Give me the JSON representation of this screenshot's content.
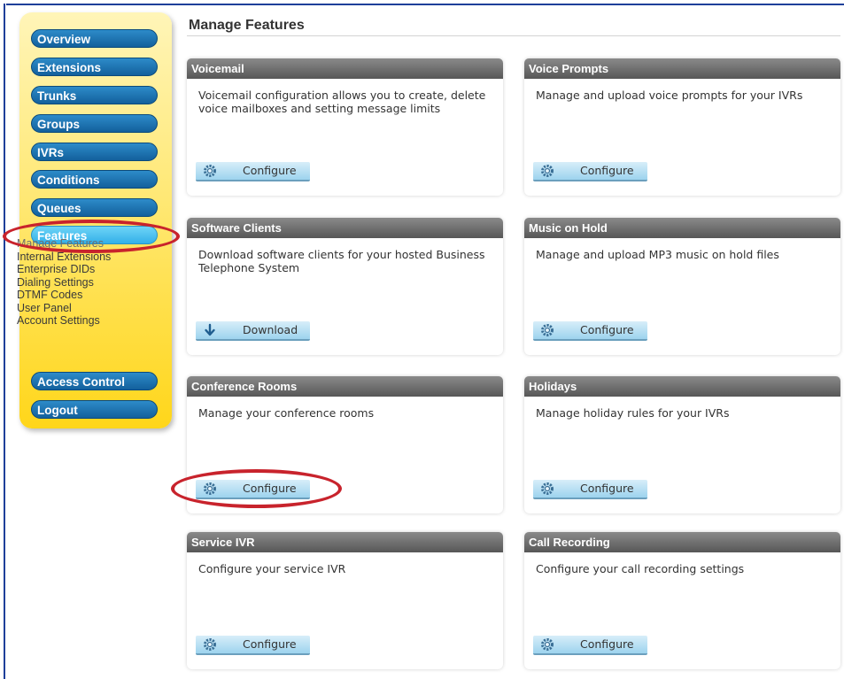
{
  "sidebar": {
    "items": [
      {
        "label": "Overview"
      },
      {
        "label": "Extensions"
      },
      {
        "label": "Trunks"
      },
      {
        "label": "Groups"
      },
      {
        "label": "IVRs"
      },
      {
        "label": "Conditions"
      },
      {
        "label": "Queues"
      },
      {
        "label": "Features",
        "active": true
      },
      {
        "label": "Access Control"
      },
      {
        "label": "Logout"
      }
    ],
    "submenu": [
      {
        "label": "Manage Features",
        "current": true
      },
      {
        "label": "Internal Extensions"
      },
      {
        "label": "Enterprise DIDs"
      },
      {
        "label": "Dialing Settings"
      },
      {
        "label": "DTMF Codes"
      },
      {
        "label": "User Panel"
      },
      {
        "label": "Account Settings"
      }
    ]
  },
  "page_title": "Manage Features",
  "cards": [
    {
      "title": "Voicemail",
      "description": "Voicemail configuration allows you to create, delete voice mailboxes and setting message limits",
      "button": "Configure",
      "icon": "gear-icon"
    },
    {
      "title": "Voice Prompts",
      "description": "Manage and upload voice prompts for your IVRs",
      "button": "Configure",
      "icon": "gear-icon"
    },
    {
      "title": "Software Clients",
      "description": "Download software clients for your hosted Business Telephone System",
      "button": "Download",
      "icon": "download-arrow-icon"
    },
    {
      "title": "Music on Hold",
      "description": "Manage and upload MP3 music on hold files",
      "button": "Configure",
      "icon": "gear-icon"
    },
    {
      "title": "Conference Rooms",
      "description": "Manage your conference rooms",
      "button": "Configure",
      "icon": "gear-icon"
    },
    {
      "title": "Holidays",
      "description": "Manage holiday rules for your IVRs",
      "button": "Configure",
      "icon": "gear-icon"
    },
    {
      "title": "Service IVR",
      "description": "Configure your service IVR",
      "button": "Configure",
      "icon": "gear-icon"
    },
    {
      "title": "Call Recording",
      "description": "Configure your call recording settings",
      "button": "Configure",
      "icon": "gear-icon"
    }
  ],
  "annotations": {
    "highlight_color": "#c8232c",
    "highlighted": [
      "Features",
      "Conference Rooms Configure"
    ]
  },
  "colors": {
    "nav_button": "#1a6fae",
    "nav_active": "#45bdee",
    "sidebar_bg": "#ffe35a",
    "card_header": "#6e6e6e",
    "button_bg": "#b9e0f3",
    "frame": "#1e3f9a"
  }
}
